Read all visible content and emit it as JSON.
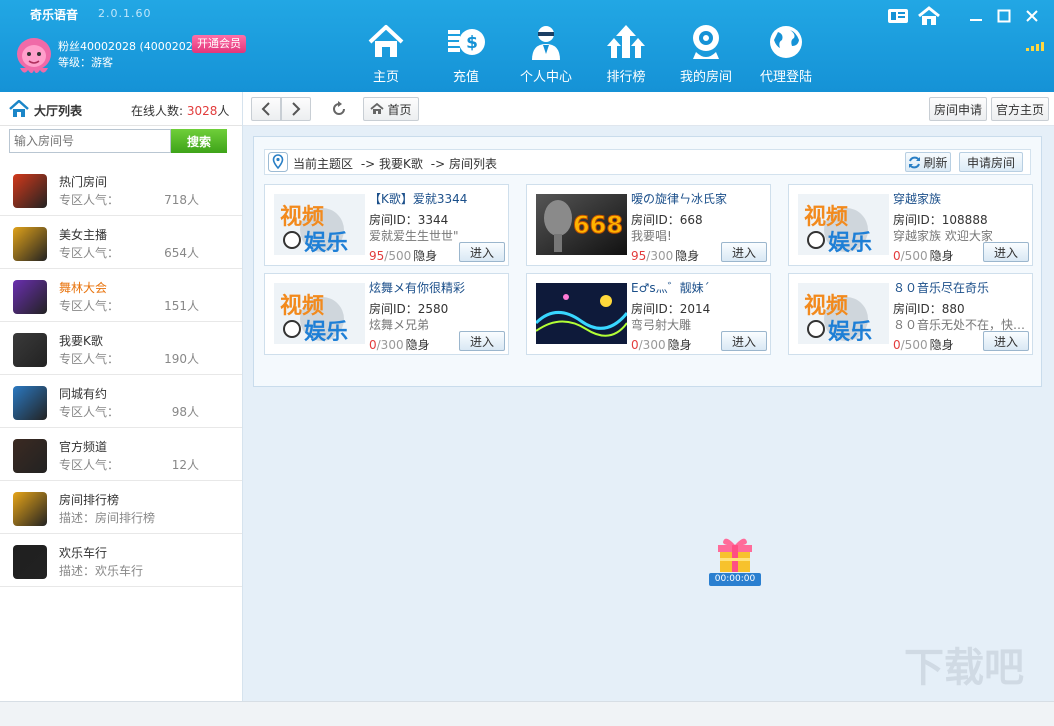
{
  "app": {
    "name": "奇乐语音",
    "version": "2.0.1.60"
  },
  "user": {
    "fans": "粉丝40002028 (40002028)",
    "vip_label": "开通会员",
    "level": "等级：游客"
  },
  "nav": [
    {
      "label": "主页",
      "icon": "home-icon"
    },
    {
      "label": "充值",
      "icon": "recharge-icon"
    },
    {
      "label": "个人中心",
      "icon": "profile-icon"
    },
    {
      "label": "排行榜",
      "icon": "ranking-icon"
    },
    {
      "label": "我的房间",
      "icon": "webcam-icon"
    },
    {
      "label": "代理登陆",
      "icon": "globe-icon"
    }
  ],
  "sidebar": {
    "title": "大厅列表",
    "online_label": "在线人数:",
    "online_count": "3028",
    "online_unit": "人",
    "search_placeholder": "输入房间号",
    "search_button": "搜索",
    "items": [
      {
        "name": "热门房间",
        "desc": "专区人气：",
        "count": "718人",
        "color": "#d2391b"
      },
      {
        "name": "美女主播",
        "desc": "专区人气：",
        "count": "654人",
        "color": "#e0a21a"
      },
      {
        "name": "舞林大会",
        "desc": "专区人气：",
        "count": "151人",
        "color": "#6a2fb0",
        "active": true
      },
      {
        "name": "我要K歌",
        "desc": "专区人气：",
        "count": "190人",
        "color": "#3a3a3a"
      },
      {
        "name": "同城有约",
        "desc": "专区人气：",
        "count": "98人",
        "color": "#2b79c2"
      },
      {
        "name": "官方频道",
        "desc": "专区人气：",
        "count": "12人",
        "color": "#3b2a22"
      },
      {
        "name": "房间排行榜",
        "desc": "描述：房间排行榜",
        "count": "",
        "color": "#e7a518"
      },
      {
        "name": "欢乐车行",
        "desc": "描述：欢乐车行",
        "count": "",
        "color": "#1f1f1f"
      }
    ]
  },
  "toolbar": {
    "home_label": "首页",
    "apply_room": "房间申请",
    "official_home": "官方主页"
  },
  "breadcrumb": {
    "part1": "当前主题区",
    "part2": "-> 我要K歌",
    "part3": "-> 房间列表",
    "refresh": "刷新",
    "apply": "申请房间"
  },
  "rooms": [
    {
      "name": "【K歌】爱就3344",
      "id": "房间ID：3344",
      "desc": "爱就爱生生世世\"",
      "current": "95",
      "max": "/500",
      "hidden": "隐身",
      "enter": "进入",
      "thumb": "video"
    },
    {
      "name": "嗳の旋律ㄣ冰氏家",
      "id": "房间ID：668",
      "desc": "我要唱!",
      "current": "95",
      "max": "/300",
      "hidden": "隐身",
      "enter": "进入",
      "thumb": "668"
    },
    {
      "name": "穿越家族",
      "id": "房间ID：108888",
      "desc": "穿越家族  欢迎大家",
      "current": "0",
      "max": "/500",
      "hidden": "隐身",
      "enter": "进入",
      "thumb": "video"
    },
    {
      "name": "炫舞メ有你很精彩",
      "id": "房间ID：2580",
      "desc": "炫舞メ兄弟",
      "current": "0",
      "max": "/300",
      "hidden": "隐身",
      "enter": "进入",
      "thumb": "video"
    },
    {
      "name": "E♂s灬゛靓妹ˊ",
      "id": "房间ID：2014",
      "desc": "弯弓射大雕",
      "current": "0",
      "max": "/300",
      "hidden": "隐身",
      "enter": "进入",
      "thumb": "music"
    },
    {
      "name": "８０音乐尽在奇乐",
      "id": "房间ID：880",
      "desc": "８０音乐无处不在，快…",
      "current": "0",
      "max": "/500",
      "hidden": "隐身",
      "enter": "进入",
      "thumb": "video"
    }
  ],
  "thumb_text": {
    "video1": "视频",
    "video2": "娱乐",
    "room668": "668"
  },
  "gift": {
    "timer": "00:00:00"
  },
  "watermark": "下载吧"
}
